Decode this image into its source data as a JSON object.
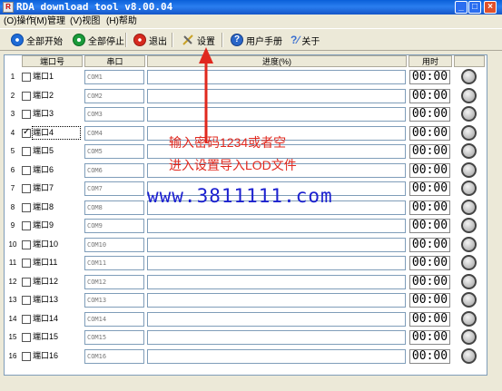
{
  "window": {
    "title": "RDA download tool v8.00.04",
    "icon": "app-icon"
  },
  "menu": [
    "(O)操作",
    "(M)管理",
    "(V)视图",
    "(H)帮助"
  ],
  "toolbar": {
    "start_all": "全部开始",
    "stop_all": "全部停止",
    "exit": "退出",
    "settings": "设置",
    "manual": "用户手册",
    "about": "关于"
  },
  "columns": {
    "port": "端口号",
    "serial": "串口",
    "progress": "进度(%)",
    "time": "用时"
  },
  "rows": [
    {
      "num": "1",
      "port": "端口1",
      "com": "COM1",
      "time": "00:00",
      "checked": false
    },
    {
      "num": "2",
      "port": "端口2",
      "com": "COM2",
      "time": "00:00",
      "checked": false
    },
    {
      "num": "3",
      "port": "端口3",
      "com": "COM3",
      "time": "00:00",
      "checked": false
    },
    {
      "num": "4",
      "port": "端口4",
      "com": "COM4",
      "time": "00:00",
      "checked": true
    },
    {
      "num": "5",
      "port": "端口5",
      "com": "COM5",
      "time": "00:00",
      "checked": false
    },
    {
      "num": "6",
      "port": "端口6",
      "com": "COM6",
      "time": "00:00",
      "checked": false
    },
    {
      "num": "7",
      "port": "端口7",
      "com": "COM7",
      "time": "00:00",
      "checked": false
    },
    {
      "num": "8",
      "port": "端口8",
      "com": "COM8",
      "time": "00:00",
      "checked": false
    },
    {
      "num": "9",
      "port": "端口9",
      "com": "COM9",
      "time": "00:00",
      "checked": false
    },
    {
      "num": "10",
      "port": "端口10",
      "com": "COM10",
      "time": "00:00",
      "checked": false
    },
    {
      "num": "11",
      "port": "端口11",
      "com": "COM11",
      "time": "00:00",
      "checked": false
    },
    {
      "num": "12",
      "port": "端口12",
      "com": "COM12",
      "time": "00:00",
      "checked": false
    },
    {
      "num": "13",
      "port": "端口13",
      "com": "COM13",
      "time": "00:00",
      "checked": false
    },
    {
      "num": "14",
      "port": "端口14",
      "com": "COM14",
      "time": "00:00",
      "checked": false
    },
    {
      "num": "15",
      "port": "端口15",
      "com": "COM15",
      "time": "00:00",
      "checked": false
    },
    {
      "num": "16",
      "port": "端口16",
      "com": "COM16",
      "time": "00:00",
      "checked": false
    }
  ],
  "annotations": {
    "line1": "输入密码1234或者空",
    "line2": "进入设置导入LOD文件",
    "website": "www.3811111.com"
  },
  "colors": {
    "annotation_red": "#e0281e",
    "website_blue": "#1b1fd0",
    "titlebar_blue": "#0a5fd8"
  }
}
